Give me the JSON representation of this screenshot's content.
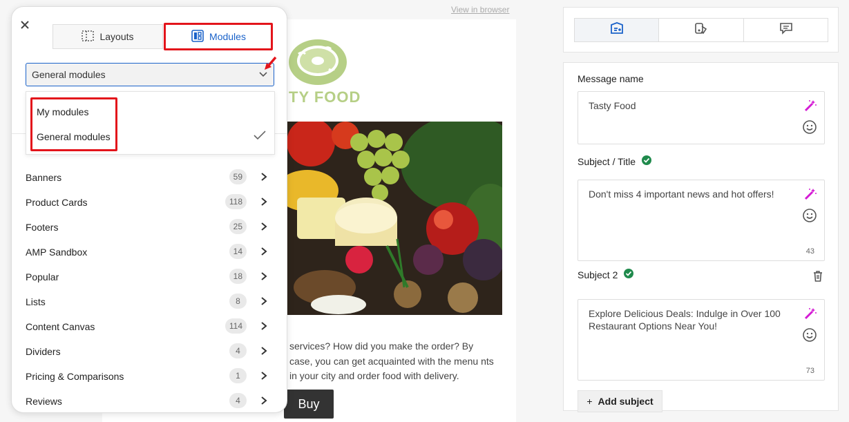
{
  "email": {
    "view_in_browser": "View in browser",
    "logo_text": "TY FOOD",
    "body_text": "services? How did you make the order? By case, you can get acquainted with the menu nts in your city and order food with delivery.",
    "buy_label": "Buy"
  },
  "panel": {
    "close_icon": "close-icon",
    "tabs": [
      {
        "label": "Layouts",
        "icon": "layouts-icon"
      },
      {
        "label": "Modules",
        "icon": "modules-icon"
      }
    ],
    "select": {
      "value": "General modules"
    },
    "dropdown": {
      "options": [
        "My modules",
        "General modules"
      ],
      "selected": "General modules"
    },
    "categories": [
      {
        "label": "Banners",
        "count": "59"
      },
      {
        "label": "Product Cards",
        "count": "118"
      },
      {
        "label": "Footers",
        "count": "25"
      },
      {
        "label": "AMP Sandbox",
        "count": "14"
      },
      {
        "label": "Popular",
        "count": "18"
      },
      {
        "label": "Lists",
        "count": "8"
      },
      {
        "label": "Content Canvas",
        "count": "114"
      },
      {
        "label": "Dividers",
        "count": "4"
      },
      {
        "label": "Pricing & Comparisons",
        "count": "1"
      },
      {
        "label": "Reviews",
        "count": "4"
      }
    ]
  },
  "right": {
    "message_name_label": "Message name",
    "message_name_value": "Tasty Food",
    "subject_label": "Subject / Title",
    "subject_value": "Don't miss 4 important news and hot offers!",
    "subject_count": "43",
    "subject2_label": "Subject 2",
    "subject2_value": "Explore Delicious Deals: Indulge in Over 100 Restaurant Options Near You!",
    "subject2_count": "73",
    "add_subject_label": "Add subject"
  },
  "colors": {
    "accent": "#1a62c9",
    "highlight_red": "#e3141b",
    "check_green": "#1f8a4c",
    "wand_magenta": "#d41bd4",
    "logo_green": "#b6cf86"
  }
}
